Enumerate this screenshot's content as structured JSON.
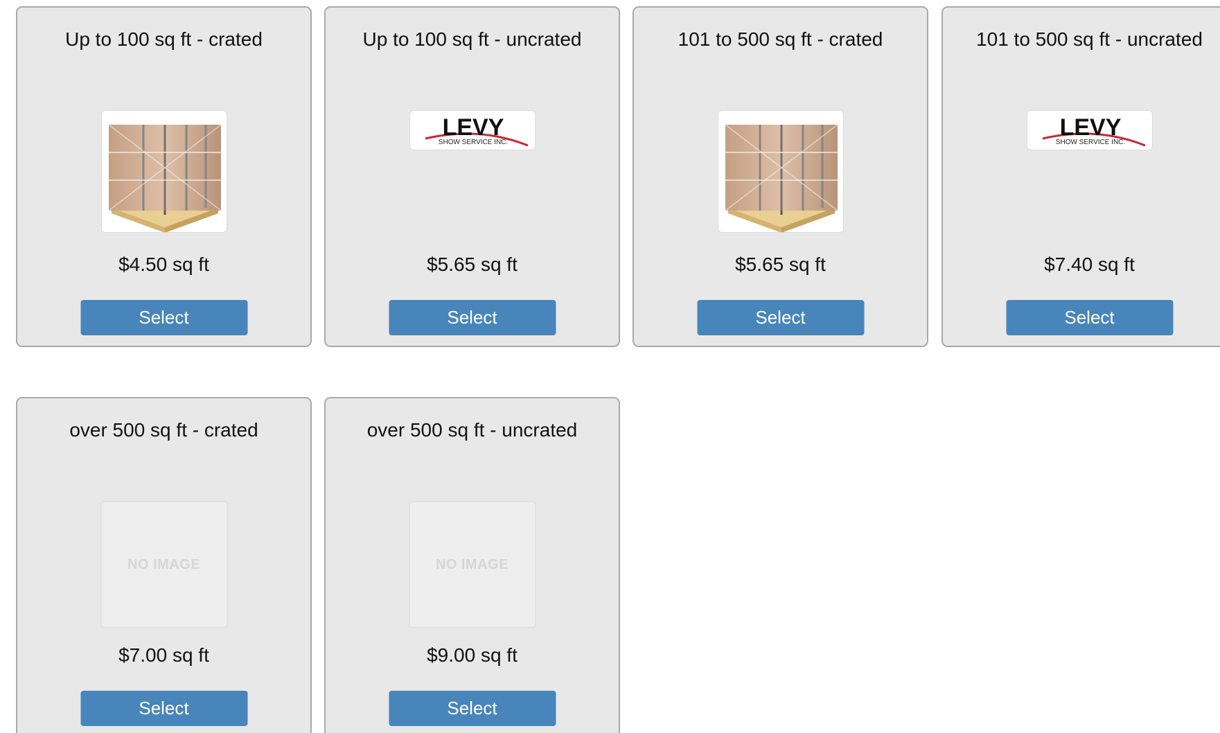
{
  "cards": [
    {
      "title": "Up to 100 sq ft - crated",
      "price": "$4.50 sq ft",
      "button_label": "Select",
      "image": "crate-pallet-icon"
    },
    {
      "title": "Up to 100 sq ft - uncrated",
      "price": "$5.65 sq ft",
      "button_label": "Select",
      "image": "levy-logo",
      "logo_text": "LEVY",
      "logo_subtext": "SHOW SERVICE INC."
    },
    {
      "title": "101 to 500 sq ft - crated",
      "price": "$5.65 sq ft",
      "button_label": "Select",
      "image": "crate-pallet-icon"
    },
    {
      "title": "101 to 500 sq ft - uncrated",
      "price": "$7.40 sq ft",
      "button_label": "Select",
      "image": "levy-logo",
      "logo_text": "LEVY",
      "logo_subtext": "SHOW SERVICE INC."
    },
    {
      "title": "over 500 sq ft - crated",
      "price": "$7.00 sq ft",
      "button_label": "Select",
      "image": "no-image-placeholder",
      "placeholder_text": "NO IMAGE"
    },
    {
      "title": "over 500 sq ft - uncrated",
      "price": "$9.00 sq ft",
      "button_label": "Select",
      "image": "no-image-placeholder",
      "placeholder_text": "NO IMAGE"
    }
  ],
  "colors": {
    "card_background": "#e8e8e8",
    "card_border": "#a9a9a9",
    "button": "#4785bb",
    "button_text": "#ffffff",
    "logo_accent": "#c8282d"
  }
}
